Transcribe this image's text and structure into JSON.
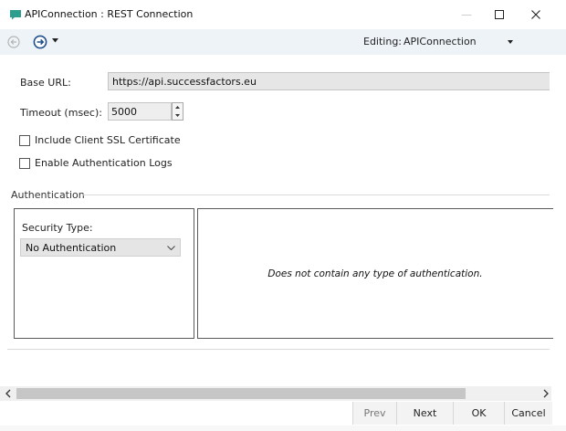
{
  "window": {
    "title": "APIConnection : REST Connection",
    "accent_color": "#2e9e8f"
  },
  "window_controls": {
    "minimize_icon": "minimize-icon",
    "maximize_icon": "maximize-icon",
    "close_icon": "close-icon"
  },
  "toolbar": {
    "back_icon": "back-arrow-icon",
    "forward_icon": "forward-arrow-icon",
    "editing_label": "Editing:",
    "editing_value": "APIConnection"
  },
  "form": {
    "base_url_label": "Base URL:",
    "base_url_value": "https://api.successfactors.eu",
    "timeout_label": "Timeout (msec):",
    "timeout_value": "5000",
    "include_ssl_label": "Include Client SSL Certificate",
    "include_ssl_checked": false,
    "enable_logs_label": "Enable Authentication Logs",
    "enable_logs_checked": false
  },
  "authentication": {
    "group_title": "Authentication",
    "security_type_label": "Security Type:",
    "security_type_value": "No Authentication",
    "message": "Does not contain any type of authentication."
  },
  "footer": {
    "prev_label": "Prev",
    "next_label": "Next",
    "ok_label": "OK",
    "cancel_label": "Cancel"
  }
}
